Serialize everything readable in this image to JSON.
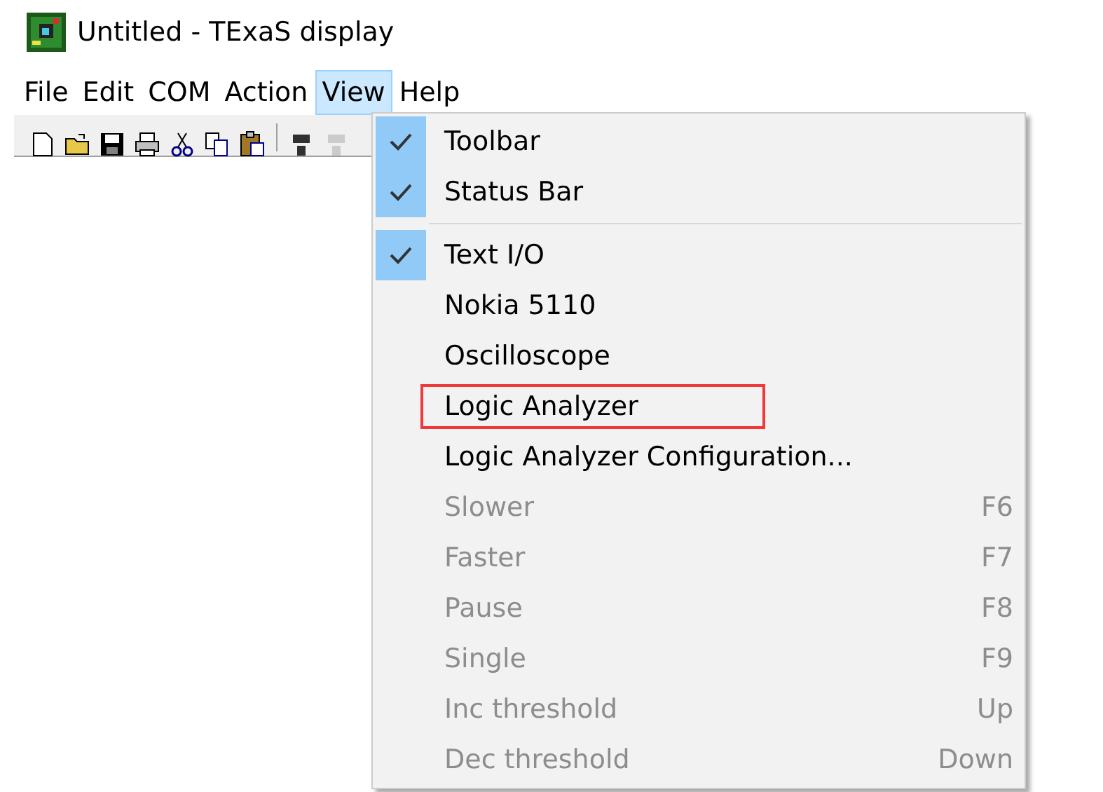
{
  "window": {
    "title": "Untitled - TExaS display"
  },
  "menu_bar": [
    {
      "label": "File",
      "selected": false
    },
    {
      "label": "Edit",
      "selected": false
    },
    {
      "label": "COM",
      "selected": false
    },
    {
      "label": "Action",
      "selected": false
    },
    {
      "label": "View",
      "selected": true
    },
    {
      "label": "Help",
      "selected": false
    }
  ],
  "toolbar": [
    {
      "kind": "new",
      "disabled": false
    },
    {
      "kind": "open",
      "disabled": false
    },
    {
      "kind": "save",
      "disabled": false
    },
    {
      "kind": "print",
      "disabled": false
    },
    {
      "kind": "cut",
      "disabled": false
    },
    {
      "kind": "copy",
      "disabled": false
    },
    {
      "kind": "paste",
      "disabled": false
    },
    {
      "kind": "separator"
    },
    {
      "kind": "lab",
      "disabled": false
    },
    {
      "kind": "lab",
      "disabled": true
    }
  ],
  "view_menu": [
    {
      "label": "Toolbar",
      "checked": true,
      "disabled": false,
      "highlighted": false
    },
    {
      "label": "Status Bar",
      "checked": true,
      "disabled": false,
      "highlighted": false
    },
    {
      "kind": "separator"
    },
    {
      "label": "Text I/O",
      "checked": true,
      "disabled": false,
      "highlighted": false
    },
    {
      "label": "Nokia 5110",
      "checked": false,
      "disabled": false,
      "highlighted": false
    },
    {
      "label": "Oscilloscope",
      "checked": false,
      "disabled": false,
      "highlighted": false
    },
    {
      "label": "Logic Analyzer",
      "checked": false,
      "disabled": false,
      "highlighted": true
    },
    {
      "label": "Logic Analyzer Configuration...",
      "checked": false,
      "disabled": false,
      "highlighted": false
    },
    {
      "label": "Slower",
      "shortcut": "F6",
      "checked": false,
      "disabled": true,
      "highlighted": false
    },
    {
      "label": "Faster",
      "shortcut": "F7",
      "checked": false,
      "disabled": true,
      "highlighted": false
    },
    {
      "label": "Pause",
      "shortcut": "F8",
      "checked": false,
      "disabled": true,
      "highlighted": false
    },
    {
      "label": "Single",
      "shortcut": "F9",
      "checked": false,
      "disabled": true,
      "highlighted": false
    },
    {
      "label": "Inc threshold",
      "shortcut": "Up",
      "checked": false,
      "disabled": true,
      "highlighted": false
    },
    {
      "label": "Dec threshold",
      "shortcut": "Down",
      "checked": false,
      "disabled": true,
      "highlighted": false
    }
  ]
}
